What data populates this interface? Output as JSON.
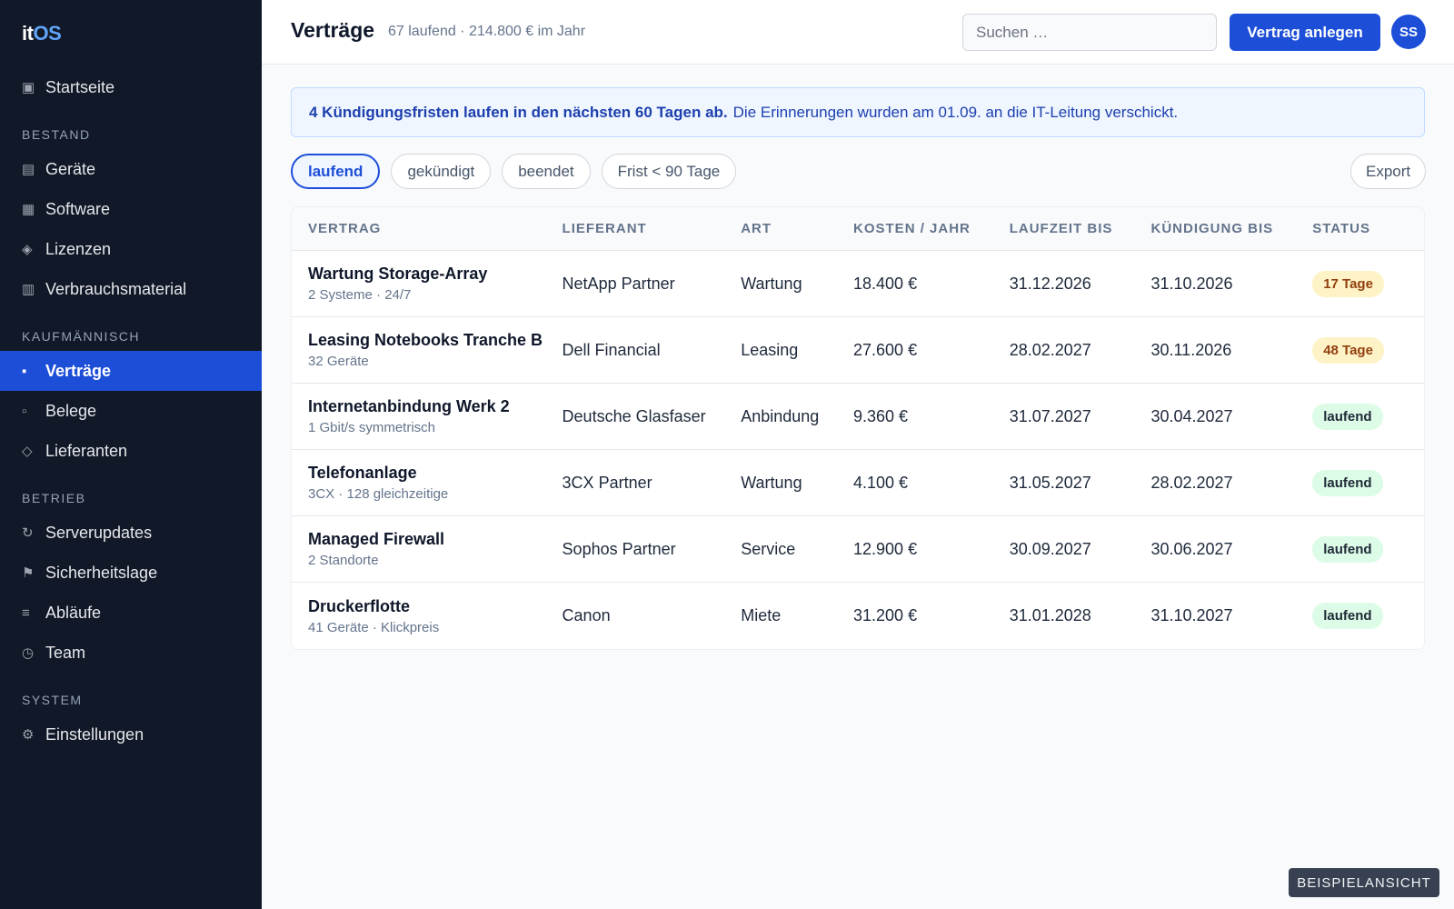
{
  "app": {
    "logo_a": "it",
    "logo_b": "OS"
  },
  "sidebar": {
    "home": {
      "icon": "▣",
      "label": "Startseite"
    },
    "sections": [
      {
        "title": "BESTAND",
        "items": [
          {
            "icon": "▤",
            "label": "Geräte"
          },
          {
            "icon": "▦",
            "label": "Software"
          },
          {
            "icon": "◈",
            "label": "Lizenzen"
          },
          {
            "icon": "▥",
            "label": "Verbrauchsmaterial"
          }
        ]
      },
      {
        "title": "KAUFMÄNNISCH",
        "items": [
          {
            "icon": "▪",
            "label": "Verträge"
          },
          {
            "icon": "▫",
            "label": "Belege"
          },
          {
            "icon": "◇",
            "label": "Lieferanten"
          }
        ]
      },
      {
        "title": "BETRIEB",
        "items": [
          {
            "icon": "↻",
            "label": "Serverupdates"
          },
          {
            "icon": "⚑",
            "label": "Sicherheitslage"
          },
          {
            "icon": "≡",
            "label": "Abläufe"
          },
          {
            "icon": "◷",
            "label": "Team"
          }
        ]
      },
      {
        "title": "SYSTEM",
        "items": [
          {
            "icon": "⚙",
            "label": "Einstellungen"
          }
        ]
      }
    ]
  },
  "header": {
    "title": "Verträge",
    "subtitle": "67 laufend · 214.800 € im Jahr",
    "search_placeholder": "Suchen …",
    "primary_button": "Vertrag anlegen",
    "avatar_initials": "SS"
  },
  "banner": {
    "strong": "4 Kündigungsfristen laufen in den nächsten 60 Tagen ab.",
    "text": "Die Erinnerungen wurden am 01.09. an die IT-Leitung verschickt."
  },
  "filters": {
    "chips": [
      "laufend",
      "gekündigt",
      "beendet",
      "Frist < 90 Tage"
    ],
    "active": "laufend",
    "export_label": "Export"
  },
  "table": {
    "columns": [
      "VERTRAG",
      "LIEFERANT",
      "ART",
      "KOSTEN / JAHR",
      "LAUFZEIT BIS",
      "KÜNDIGUNG BIS",
      "STATUS"
    ],
    "rows": [
      {
        "name": "Wartung Storage-Array",
        "sub": "2 Systeme · 24/7",
        "vendor": "NetApp Partner",
        "type": "Wartung",
        "cost": "18.400 €",
        "until": "31.12.2026",
        "notice": "31.10.2026",
        "status": "17 Tage",
        "status_kind": "warn"
      },
      {
        "name": "Leasing Notebooks Tranche B",
        "sub": "32 Geräte",
        "vendor": "Dell Financial",
        "type": "Leasing",
        "cost": "27.600 €",
        "until": "28.02.2027",
        "notice": "30.11.2026",
        "status": "48 Tage",
        "status_kind": "warn"
      },
      {
        "name": "Internetanbindung Werk 2",
        "sub": "1 Gbit/s symmetrisch",
        "vendor": "Deutsche Glasfaser",
        "type": "Anbindung",
        "cost": "9.360 €",
        "until": "31.07.2027",
        "notice": "30.04.2027",
        "status": "laufend",
        "status_kind": "ok"
      },
      {
        "name": "Telefonanlage",
        "sub": "3CX · 128 gleichzeitige",
        "vendor": "3CX Partner",
        "type": "Wartung",
        "cost": "4.100 €",
        "until": "31.05.2027",
        "notice": "28.02.2027",
        "status": "laufend",
        "status_kind": "ok"
      },
      {
        "name": "Managed Firewall",
        "sub": "2 Standorte",
        "vendor": "Sophos Partner",
        "type": "Service",
        "cost": "12.900 €",
        "until": "30.09.2027",
        "notice": "30.06.2027",
        "status": "laufend",
        "status_kind": "ok"
      },
      {
        "name": "Druckerflotte",
        "sub": "41 Geräte · Klickpreis",
        "vendor": "Canon",
        "type": "Miete",
        "cost": "31.200 €",
        "until": "31.01.2028",
        "notice": "31.10.2027",
        "status": "laufend",
        "status_kind": "ok"
      }
    ]
  },
  "watermark": "BEISPIELANSICHT"
}
